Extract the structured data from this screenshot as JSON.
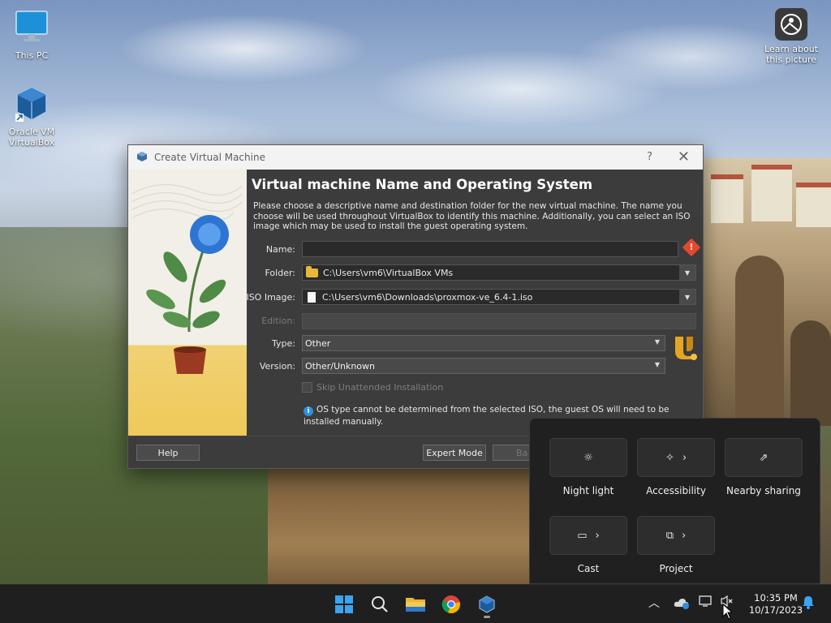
{
  "desktop": {
    "icons": [
      {
        "label": "This PC"
      },
      {
        "label": "Oracle VM VirtualBox"
      },
      {
        "label": "Learn about this picture"
      }
    ]
  },
  "dialog": {
    "window_title": "Create Virtual Machine",
    "help_glyph": "?",
    "close_glyph": "✕",
    "heading": "Virtual machine Name and Operating System",
    "description": "Please choose a descriptive name and destination folder for the new virtual machine. The name you choose will be used throughout VirtualBox to identify this machine. Additionally, you can select an ISO image which may be used to install the guest operating system.",
    "fields": {
      "name_label": "Name:",
      "name_value": "",
      "folder_label": "Folder:",
      "folder_value": "C:\\Users\\vm6\\VirtualBox VMs",
      "iso_label": "ISO Image:",
      "iso_value": "C:\\Users\\vm6\\Downloads\\proxmox-ve_6.4-1.iso",
      "edition_label": "Edition:",
      "edition_value": "",
      "type_label": "Type:",
      "type_value": "Other",
      "version_label": "Version:",
      "version_value": "Other/Unknown"
    },
    "skip_unattended_label": "Skip Unattended Installation",
    "info_note": "OS type cannot be determined from the selected ISO, the guest OS will need to be installed manually.",
    "buttons": {
      "help": "Help",
      "expert_mode": "Expert Mode",
      "back_partial": "Ba"
    }
  },
  "quick_settings": {
    "tiles": [
      {
        "label": "Night light",
        "icon": "night-light-icon",
        "has_chevron": false
      },
      {
        "label": "Accessibility",
        "icon": "accessibility-icon",
        "has_chevron": true
      },
      {
        "label": "Nearby sharing",
        "icon": "nearby-sharing-icon",
        "has_chevron": false
      },
      {
        "label": "Cast",
        "icon": "cast-icon",
        "has_chevron": true
      },
      {
        "label": "Project",
        "icon": "project-icon",
        "has_chevron": true
      }
    ]
  },
  "taskbar": {
    "apps": [
      "start-icon",
      "search-icon",
      "file-explorer-icon",
      "chrome-icon",
      "virtualbox-icon"
    ],
    "clock_time": "10:35 PM",
    "clock_date": "10/17/2023"
  },
  "colors": {
    "dialog_bg": "#3c3c3c",
    "warning": "#e2492f",
    "info": "#2e8fe2",
    "taskbar_bg": "#1f1f1f"
  }
}
